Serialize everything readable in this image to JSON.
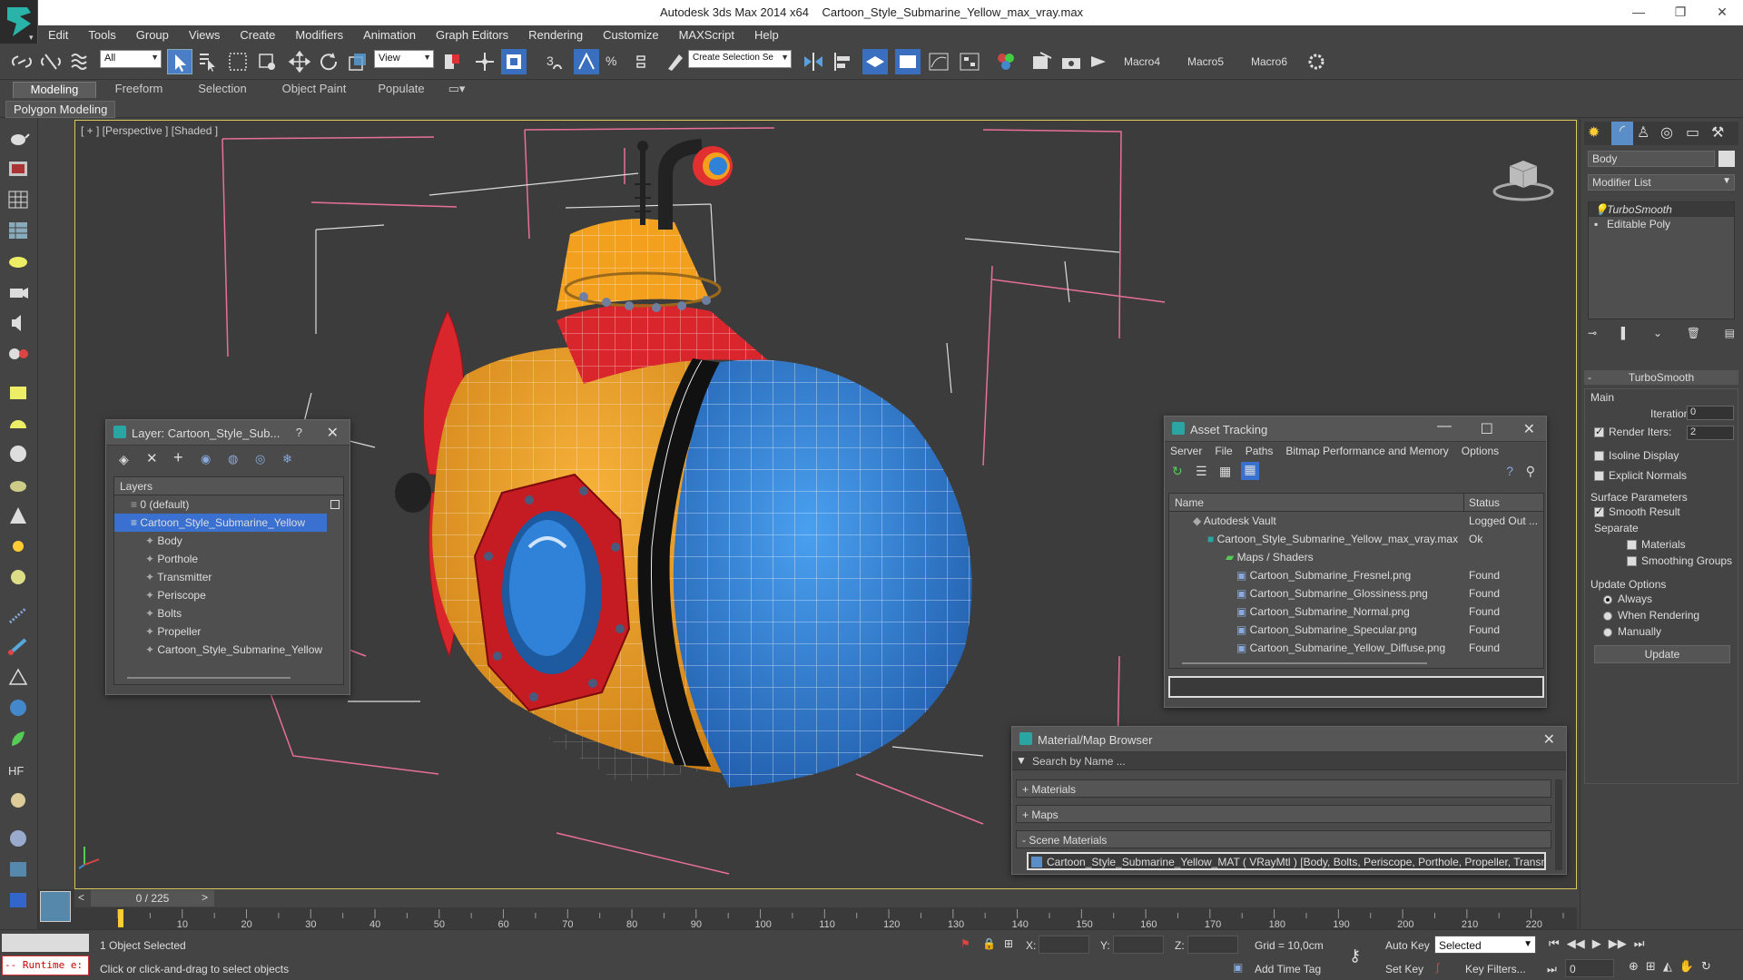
{
  "window": {
    "app_title": "Autodesk 3ds Max  2014 x64",
    "file_title": "Cartoon_Style_Submarine_Yellow_max_vray.max"
  },
  "menu": [
    "Edit",
    "Tools",
    "Group",
    "Views",
    "Create",
    "Modifiers",
    "Animation",
    "Graph Editors",
    "Rendering",
    "Customize",
    "MAXScript",
    "Help"
  ],
  "toolbar": {
    "selection_filter": "All",
    "reference_coord": "View",
    "named_selection_placeholder": "Create Selection Se",
    "macros": [
      "Macro4",
      "Macro5",
      "Macro6"
    ]
  },
  "ribbon": {
    "tabs": [
      "Modeling",
      "Freeform",
      "Selection",
      "Object Paint",
      "Populate"
    ],
    "active_tab": "Modeling",
    "sub_label": "Polygon Modeling"
  },
  "viewport": {
    "label": "[ + ] [Perspective ] [Shaded ]"
  },
  "layer_panel": {
    "title": "Layer: Cartoon_Style_Sub...",
    "help": "?",
    "header": "Layers",
    "rows": [
      {
        "label": "0 (default)",
        "level": 0,
        "selected": false
      },
      {
        "label": "Cartoon_Style_Submarine_Yellow",
        "level": 0,
        "selected": true
      },
      {
        "label": "Body",
        "level": 1,
        "selected": false
      },
      {
        "label": "Porthole",
        "level": 1,
        "selected": false
      },
      {
        "label": "Transmitter",
        "level": 1,
        "selected": false
      },
      {
        "label": "Periscope",
        "level": 1,
        "selected": false
      },
      {
        "label": "Bolts",
        "level": 1,
        "selected": false
      },
      {
        "label": "Propeller",
        "level": 1,
        "selected": false
      },
      {
        "label": "Cartoon_Style_Submarine_Yellow",
        "level": 1,
        "selected": false
      }
    ]
  },
  "asset_tracking": {
    "title": "Asset Tracking",
    "menu": [
      "Server",
      "File",
      "Paths",
      "Bitmap Performance and Memory",
      "Options"
    ],
    "col_name": "Name",
    "col_status": "Status",
    "rows": [
      {
        "name": "Autodesk Vault",
        "status": "Logged Out ...",
        "level": 0
      },
      {
        "name": "Cartoon_Style_Submarine_Yellow_max_vray.max",
        "status": "Ok",
        "level": 1
      },
      {
        "name": "Maps / Shaders",
        "status": "",
        "level": 2
      },
      {
        "name": "Cartoon_Submarine_Fresnel.png",
        "status": "Found",
        "level": 3
      },
      {
        "name": "Cartoon_Submarine_Glossiness.png",
        "status": "Found",
        "level": 3
      },
      {
        "name": "Cartoon_Submarine_Normal.png",
        "status": "Found",
        "level": 3
      },
      {
        "name": "Cartoon_Submarine_Specular.png",
        "status": "Found",
        "level": 3
      },
      {
        "name": "Cartoon_Submarine_Yellow_Diffuse.png",
        "status": "Found",
        "level": 3
      }
    ]
  },
  "material_browser": {
    "title": "Material/Map Browser",
    "search_placeholder": "Search by Name ...",
    "sections": [
      "+ Materials",
      "+ Maps",
      "- Scene Materials"
    ],
    "material_entry": "Cartoon_Style_Submarine_Yellow_MAT ( VRayMtl ) [Body, Bolts, Periscope, Porthole, Propeller, Transmitter]"
  },
  "command_panel": {
    "object_name": "Body",
    "modifier_list": "Modifier List",
    "stack": [
      "TurboSmooth",
      "Editable Poly"
    ],
    "rollout_title": "TurboSmooth",
    "main_label": "Main",
    "iterations_label": "Iterations:",
    "iterations_value": "0",
    "render_iters_label": "Render Iters:",
    "render_iters_value": "2",
    "render_iters_checked": true,
    "isoline_label": "Isoline Display",
    "explicit_label": "Explicit Normals",
    "surface_label": "Surface Parameters",
    "smooth_label": "Smooth Result",
    "separate_label": "Separate",
    "materials_label": "Materials",
    "smoothing_label": "Smoothing Groups",
    "update_options_label": "Update Options",
    "always_label": "Always",
    "when_rendering_label": "When Rendering",
    "manually_label": "Manually",
    "update_button": "Update"
  },
  "timeline": {
    "frame_display": "0 / 225",
    "ticks": [
      "10",
      "20",
      "30",
      "40",
      "50",
      "60",
      "70",
      "80",
      "90",
      "100",
      "110",
      "120",
      "130",
      "140",
      "150",
      "160",
      "170",
      "180",
      "190",
      "200",
      "210",
      "220"
    ]
  },
  "status": {
    "maxscript_mini": "-- Runtime e:",
    "objects_selected": "1 Object Selected",
    "prompt": "Click or click-and-drag to select objects",
    "x_label": "X:",
    "y_label": "Y:",
    "z_label": "Z:",
    "grid": "Grid = 10,0cm",
    "add_time_tag": "Add Time Tag",
    "auto_key": "Auto Key",
    "set_key": "Set Key",
    "selected_dropdown": "Selected",
    "key_filters": "Key Filters...",
    "current_frame": "0"
  },
  "colors": {
    "sub_yellow": "#f2a01e",
    "sub_blue": "#3b8ee0",
    "sub_red": "#d8262c",
    "select_blue": "#3a70d0"
  }
}
